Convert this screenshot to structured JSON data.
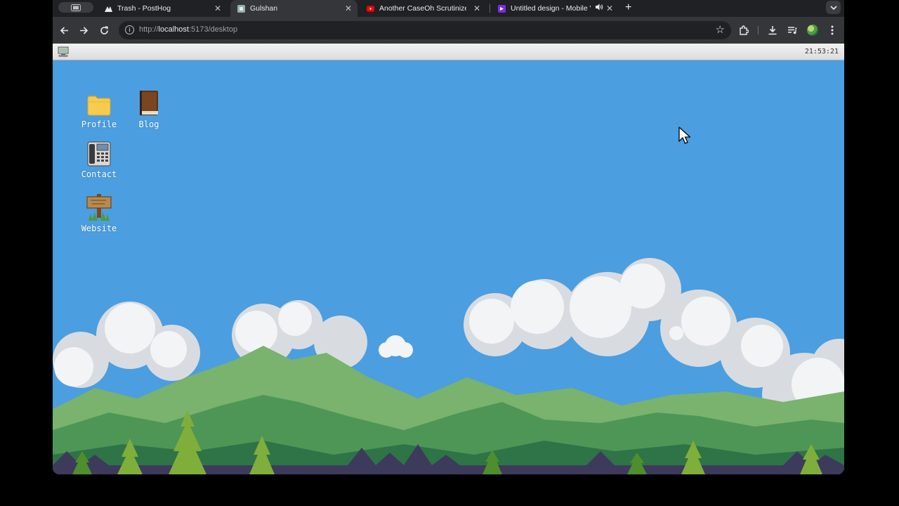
{
  "browser": {
    "tabs": [
      {
        "title": "Trash - PostHog",
        "favicon": "posthog-icon",
        "active": false
      },
      {
        "title": "Gulshan",
        "favicon": "app-icon",
        "active": true
      },
      {
        "title": "Another CaseOh Scrutinized",
        "favicon": "youtube-icon",
        "active": false
      },
      {
        "title": "Untitled design - Mobile V",
        "favicon": "canva-icon",
        "active": false,
        "audio": true
      }
    ],
    "url": {
      "scheme": "http://",
      "host": "localhost",
      "rest": ":5173/desktop"
    }
  },
  "desktop": {
    "clock": "21:53:21",
    "icons": [
      {
        "label": "Profile",
        "icon": "folder-icon"
      },
      {
        "label": "Blog",
        "icon": "book-icon"
      },
      {
        "label": "Contact",
        "icon": "telephone-icon"
      },
      {
        "label": "Website",
        "icon": "signpost-icon"
      }
    ],
    "colors": {
      "sky": "#4b9ee0",
      "folder": "#f7cb4d",
      "menubar": "#e6e6e6"
    }
  }
}
